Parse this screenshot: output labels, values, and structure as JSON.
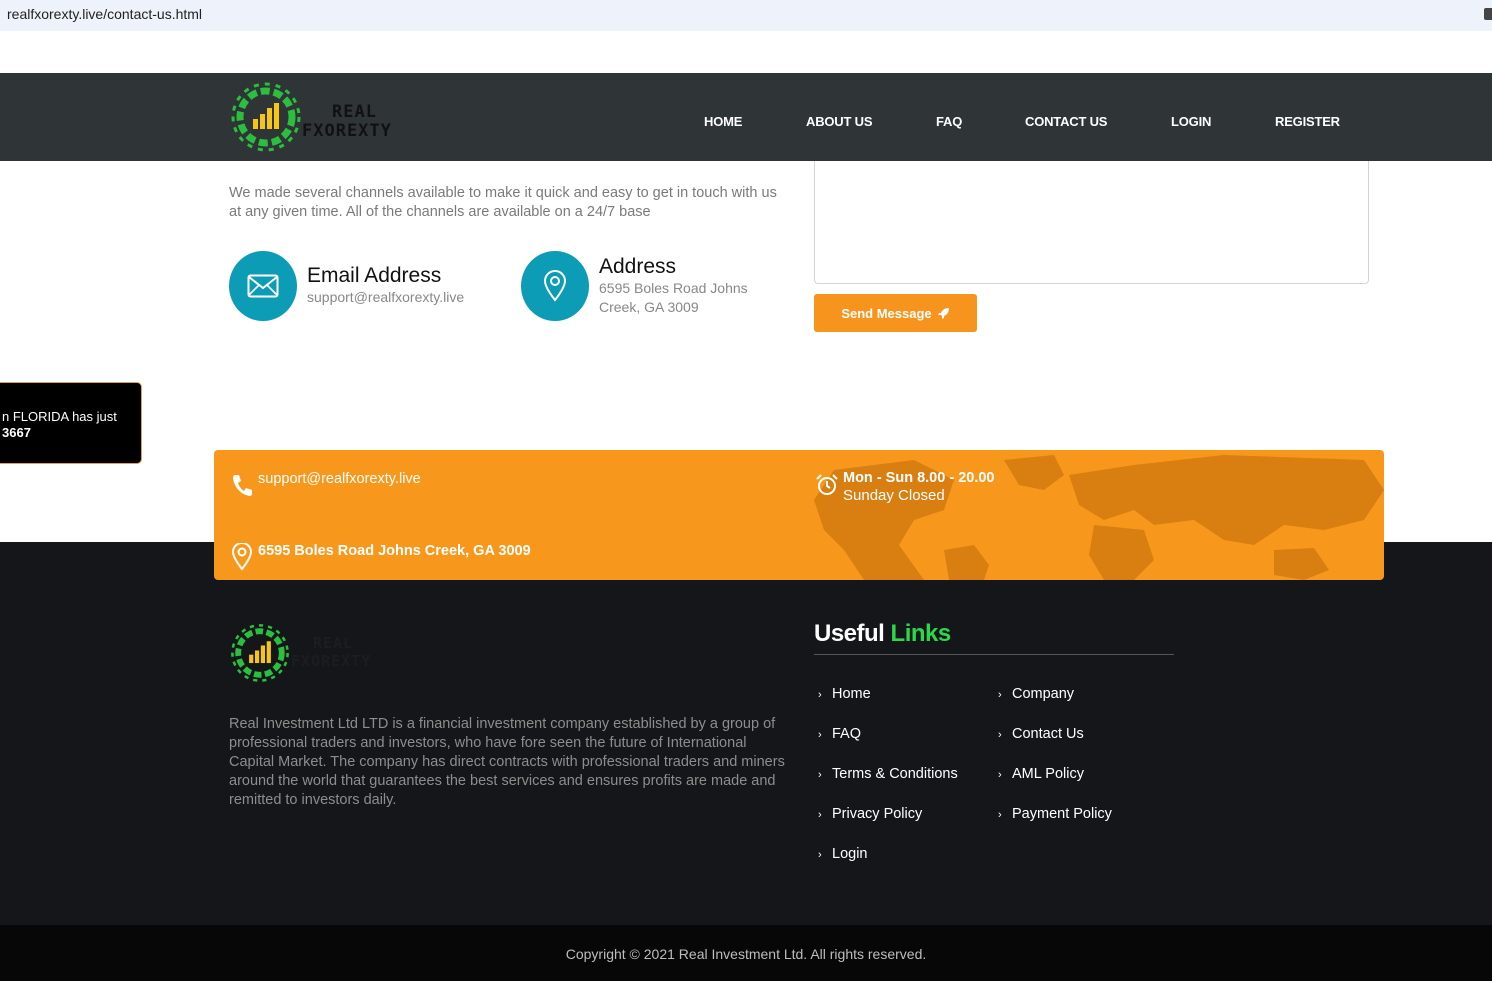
{
  "browser": {
    "url": "realfxorexty.live/contact-us.html"
  },
  "header": {
    "logo_line1": "REAL",
    "logo_line2": "FXOREXTY",
    "nav": [
      "HOME",
      "ABOUT US",
      "FAQ",
      "CONTACT US",
      "LOGIN",
      "REGISTER"
    ]
  },
  "contact": {
    "intro": "We made several channels available to make it quick and easy to get in touch with us at any given time. All of the channels are available on a 24/7 base",
    "email_title": "Email Address",
    "email_value": "support@realfxorexty.live",
    "address_title": "Address",
    "address_line1": "6595 Boles Road Johns",
    "address_line2": "Creek, GA 3009",
    "send_label": "Send Message"
  },
  "popup": {
    "line1": "n FLORIDA has just",
    "line2": "3667"
  },
  "band": {
    "email": "support@realfxorexty.live",
    "hours": "Mon - Sun 8.00 - 20.00",
    "closed": "Sunday Closed",
    "address": "6595 Boles Road Johns Creek, GA 3009"
  },
  "footer": {
    "logo_line1": "REAL",
    "logo_line2": "FXOREXTY",
    "about": "Real Investment Ltd LTD is a financial investment company established by a group of professional traders and investors, who have fore seen the future of International Capital Market. The company has direct contracts with professional traders and miners around the world that guarantees the best services and ensures profits are made and remitted to investors daily.",
    "useful_title_1": "Useful",
    "useful_title_2": "Links",
    "links_col1": [
      "Home",
      "FAQ",
      "Terms & Conditions",
      "Privacy Policy",
      "Login"
    ],
    "links_col2": [
      "Company",
      "Contact Us",
      "AML Policy",
      "Payment Policy"
    ],
    "copyright": "Copyright © 2021 Real Investment Ltd. All rights reserved."
  },
  "colors": {
    "header_bg": "#2f3437",
    "accent_orange": "#f7981d",
    "icon_teal": "#0d9cb5",
    "link_green": "#2bd84b",
    "footer_bg": "#141619"
  }
}
